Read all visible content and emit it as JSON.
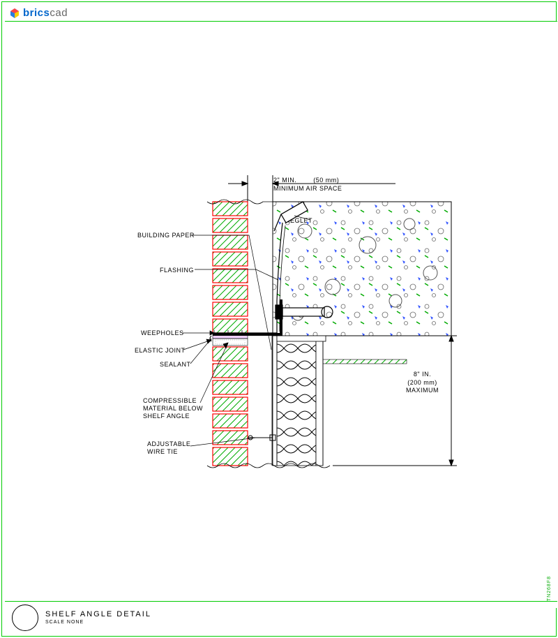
{
  "brand": {
    "part1": "brics",
    "part2": "cad"
  },
  "footer": {
    "title": "SHELF ANGLE DETAIL",
    "scale": "SCALE NONE"
  },
  "side_ref": "TN268F8",
  "dims": {
    "air_space": {
      "l1": "2\" MIN.",
      "l2": "(50 mm)",
      "l3": "MINIMUM AIR SPACE"
    },
    "max_depth": {
      "l1": "8\" IN.",
      "l2": "(200 mm)",
      "l3": "MAXIMUM"
    }
  },
  "labels": {
    "reglet": "REGLET",
    "building_paper": "BUILDING PAPER",
    "flashing": "FLASHING",
    "weepholes": "WEEPHOLES",
    "elastic_joint": "ELASTIC JOINT",
    "sealant": "SEALANT",
    "compressible": {
      "l1": "COMPRESSIBLE",
      "l2": "MATERIAL BELOW",
      "l3": "SHELF ANGLE"
    },
    "wire_tie": {
      "l1": "ADJUSTABLE",
      "l2": "WIRE TIE"
    }
  },
  "colors": {
    "brick_outer": "#ff0000",
    "brick_hatch": "#00aa00",
    "frame": "#00cc00"
  }
}
